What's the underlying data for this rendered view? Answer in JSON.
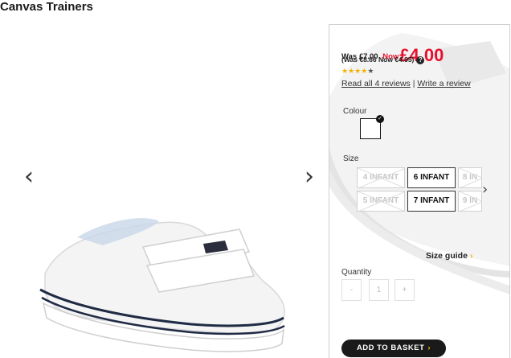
{
  "product": {
    "title": "Canvas Trainers",
    "prev_arrow": "‹",
    "next_arrow": "›"
  },
  "pricing": {
    "was_label": "Was £7.00",
    "now_label": "Now",
    "now_price": "£4.00",
    "euro_text": "(Was €8.66 Now €4.95)",
    "help_icon": "?"
  },
  "rating": {
    "stars_filled": 4,
    "stars_total": 5,
    "read_reviews": "Read all 4 reviews",
    "separator": " | ",
    "write_review": "Write a review"
  },
  "colour": {
    "label": "Colour",
    "selected": "White"
  },
  "size": {
    "label": "Size",
    "options": [
      {
        "label": "4 INFANT",
        "available": false
      },
      {
        "label": "6 INFANT",
        "available": true
      },
      {
        "label": "8 IN",
        "available": false
      },
      {
        "label": "5 INFANT",
        "available": false
      },
      {
        "label": "7 INFANT",
        "available": true
      },
      {
        "label": "9 IN",
        "available": false
      }
    ],
    "next_arrow": "›",
    "guide": "Size guide",
    "guide_arrow": "›"
  },
  "quantity": {
    "label": "Quantity",
    "minus": "-",
    "value": "1",
    "plus": "+"
  },
  "basket": {
    "label": "ADD TO BASKET",
    "arrow": "›"
  },
  "colors": {
    "price_red": "#e8112d",
    "star_gold": "#f2b203",
    "button_dark": "#1a1a1a"
  }
}
